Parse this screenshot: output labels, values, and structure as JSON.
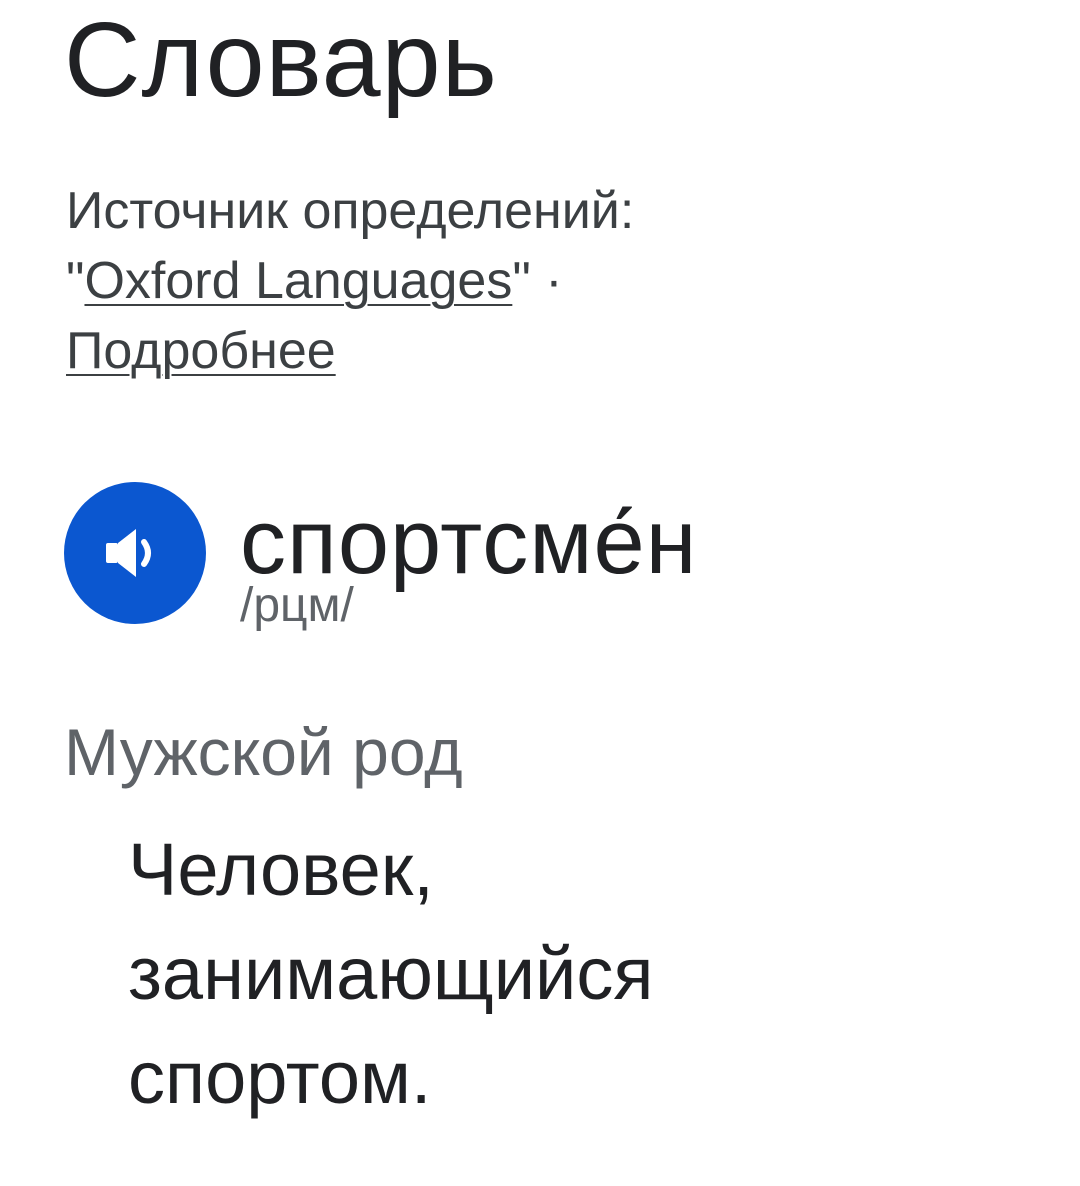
{
  "header": {
    "title": "Словарь"
  },
  "source": {
    "prefix": "Источник определений:",
    "open_quote": "\"",
    "link_label": "Oxford Languages",
    "close_quote": "\"",
    "separator": " · ",
    "more_label": "Подробнее"
  },
  "entry": {
    "speaker_icon": "speaker-icon",
    "accent_color": "#0b57d0",
    "word": "спортсме́н",
    "phonetic": "/рцм/",
    "part_of_speech": "Мужской род",
    "definition_lines": [
      "Человек,",
      "занимающийся",
      "спортом."
    ]
  }
}
